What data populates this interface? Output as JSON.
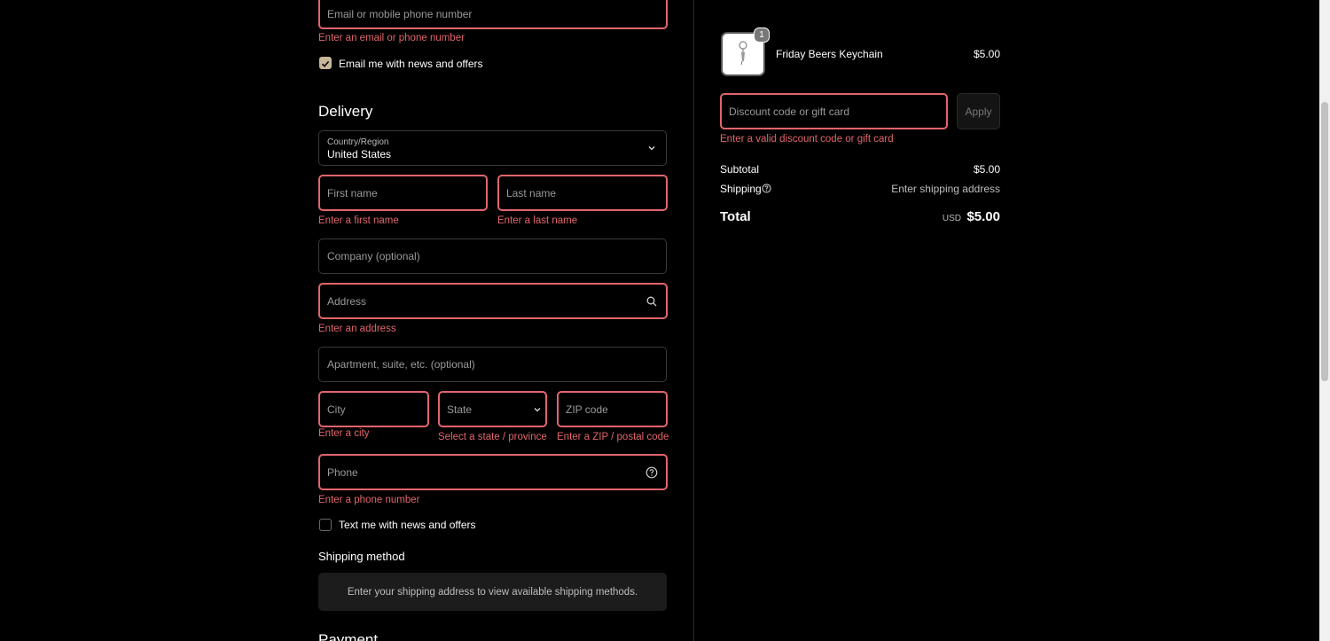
{
  "contact": {
    "email_placeholder": "Email or mobile phone number",
    "email_error": "Enter an email or phone number",
    "news_label": "Email me with news and offers"
  },
  "delivery": {
    "heading": "Delivery",
    "country_label": "Country/Region",
    "country_value": "United States",
    "first_name_placeholder": "First name",
    "first_name_error": "Enter a first name",
    "last_name_placeholder": "Last name",
    "last_name_error": "Enter a last name",
    "company_placeholder": "Company (optional)",
    "address_placeholder": "Address",
    "address_error": "Enter an address",
    "apartment_placeholder": "Apartment, suite, etc. (optional)",
    "city_placeholder": "City",
    "city_error": "Enter a city",
    "state_placeholder": "State",
    "state_error": "Select a state / province",
    "zip_placeholder": "ZIP code",
    "zip_error": "Enter a ZIP / postal code",
    "phone_placeholder": "Phone",
    "phone_error": "Enter a phone number",
    "text_news_label": "Text me with news and offers"
  },
  "shipping_method": {
    "heading": "Shipping method",
    "notice": "Enter your shipping address to view available shipping methods."
  },
  "payment": {
    "heading": "Payment"
  },
  "summary": {
    "item": {
      "quantity": "1",
      "name": "Friday Beers Keychain",
      "price": "$5.00"
    },
    "discount_placeholder": "Discount code or gift card",
    "apply_label": "Apply",
    "discount_error": "Enter a valid discount code or gift card",
    "subtotal_label": "Subtotal",
    "subtotal_value": "$5.00",
    "shipping_label": "Shipping",
    "shipping_value": "Enter shipping address",
    "total_label": "Total",
    "currency": "USD",
    "total_value": "$5.00"
  },
  "colors": {
    "error": "#e2656c",
    "checkbox_checked": "#c8b69a",
    "background": "#000000"
  }
}
